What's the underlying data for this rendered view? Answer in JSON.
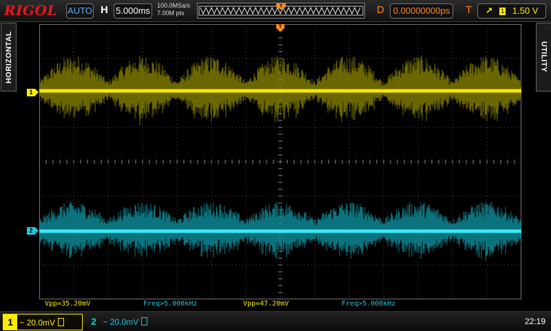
{
  "topbar": {
    "logo": "RIGOL",
    "mode": "AUTO",
    "horizontal_label": "H",
    "timebase": "5.000ms",
    "sample_rate": "100.0MSa/s",
    "memory_depth": "7.00M pts",
    "delay_label": "D",
    "delay": "0.00000000ps",
    "trigger_label": "T",
    "trigger_edge": "↗",
    "trigger_source": "1",
    "trigger_level": "1.50 V"
  },
  "side_tabs": {
    "left": "HORIZONTAL",
    "right": "UTILITY"
  },
  "channels": [
    {
      "number": "1",
      "coupling": "~",
      "scale": "20.0mV",
      "color": "#ffeb00",
      "marker": "1"
    },
    {
      "number": "2",
      "coupling": "~",
      "scale": "20.0mV",
      "color": "#1ec8e0",
      "marker": "2"
    }
  ],
  "measurements": [
    {
      "text": "Vpp=35.20mV"
    },
    {
      "text": "Freq>5.000kHz"
    },
    {
      "text": "Vpp=47.20mV"
    },
    {
      "text": "Freq>5.000kHz"
    }
  ],
  "clock": "22:19",
  "icons": [
    "trigger-position-icon",
    "edge-trigger-icon",
    "bandwidth-limit-icon"
  ]
}
